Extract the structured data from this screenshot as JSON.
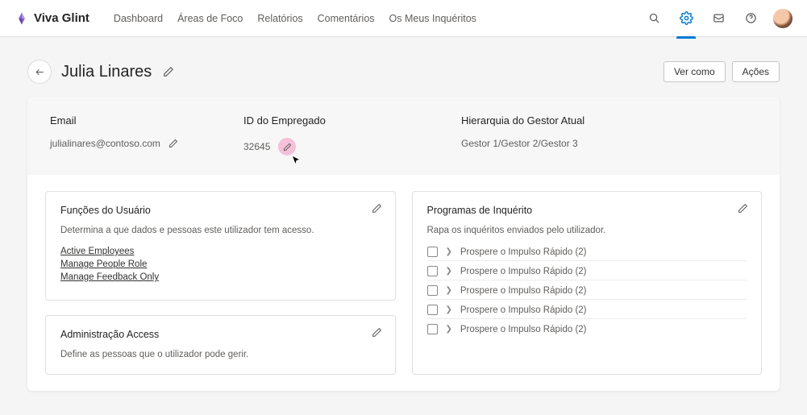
{
  "brand": "Viva Glint",
  "nav": {
    "items": [
      "Dashboard",
      "Áreas de Foco",
      "Relatórios",
      "Comentários",
      "Os Meus Inquéritos"
    ]
  },
  "header": {
    "title": "Julia Linares",
    "viewAs": "Ver como",
    "actions": "Ações"
  },
  "info": {
    "emailLabel": "Email",
    "emailValue": "julialinares@contoso.com",
    "empIdLabel": "ID do Empregado",
    "empIdValue": "32645",
    "hierLabel": "Hierarquia do Gestor Atual",
    "hierValue": "Gestor 1/Gestor 2/Gestor 3"
  },
  "roles": {
    "title": "Funções do Usuário",
    "desc": "Determina a que dados e pessoas este utilizador tem acesso.",
    "links": [
      "Active Employees",
      "Manage People Role",
      "Manage Feedback Only"
    ]
  },
  "admin": {
    "title": "Administração Access",
    "desc": "Define as pessoas que o utilizador pode gerir."
  },
  "surveys": {
    "title": "Programas de Inquérito",
    "desc": "Rapa os inquéritos enviados pelo utilizador.",
    "items": [
      "Prospere o Impulso Rápido (2)",
      "Prospere o Impulso Rápido (2)",
      "Prospere o Impulso Rápido (2)",
      "Prospere o Impulso Rápido (2)",
      "Prospere o Impulso Rápido (2)"
    ]
  }
}
